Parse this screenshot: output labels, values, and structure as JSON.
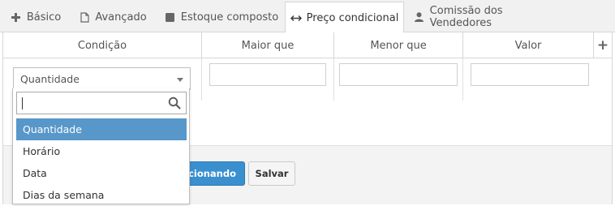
{
  "tabs": [
    {
      "label": "Básico",
      "icon": "plus-icon"
    },
    {
      "label": "Avançado",
      "icon": "file-icon"
    },
    {
      "label": "Estoque composto",
      "icon": "square-icon"
    },
    {
      "label": "Preço condicional",
      "icon": "arrows-horizontal-icon",
      "active": true
    },
    {
      "label": "Comissão dos Vendedores",
      "icon": "user-icon"
    }
  ],
  "table": {
    "headers": [
      "Condição",
      "Maior que",
      "Menor que",
      "Valor"
    ],
    "add_icon": "+",
    "condition_select": {
      "value": "Quantidade"
    },
    "inputs": {
      "maior_que": "",
      "menor_que": "",
      "valor": ""
    }
  },
  "dropdown": {
    "search_value": "",
    "options": [
      "Quantidade",
      "Horário",
      "Data",
      "Dias da semana"
    ],
    "highlighted_index": 0
  },
  "buttons": {
    "primary_label": "icionando",
    "save_label": "Salvar"
  },
  "colors": {
    "primary": "#3a8fcf",
    "highlight": "#5897c9",
    "border": "#d6d6d6"
  }
}
